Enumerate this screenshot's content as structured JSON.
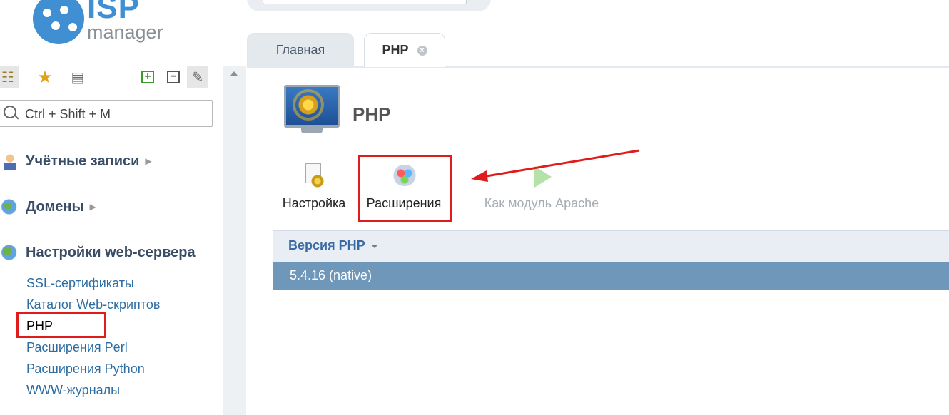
{
  "logo": {
    "top": "ISP",
    "bottom": "manager"
  },
  "sidebar": {
    "search_placeholder": "Ctrl + Shift + M",
    "groups": [
      {
        "label": "Учётные записи",
        "expandable": true
      },
      {
        "label": "Домены",
        "expandable": true
      },
      {
        "label": "Настройки web-сервера",
        "expandable": false
      }
    ],
    "subitems": [
      "SSL-сертификаты",
      "Каталог Web-скриптов",
      "PHP",
      "Расширения Perl",
      "Расширения Python",
      "WWW-журналы"
    ],
    "active_subitem": "PHP"
  },
  "tabs": [
    {
      "label": "Главная",
      "active": false
    },
    {
      "label": "PHP",
      "active": true,
      "closable": true
    }
  ],
  "page": {
    "title": "PHP"
  },
  "toolbar": {
    "settings_label": "Настройка",
    "extensions_label": "Расширения",
    "apache_label": "Как модуль Apache"
  },
  "table": {
    "column_header": "Версия PHP",
    "rows": [
      "5.4.16 (native)"
    ]
  },
  "colors": {
    "accent": "#3f8fd2",
    "highlight": "#e01b1b",
    "selected_row": "#6e97ba",
    "link": "#2e6da4"
  },
  "icons": [
    "tree-icon",
    "star-icon",
    "clipboard-icon",
    "expand-all-icon",
    "collapse-all-icon",
    "pin-icon",
    "search-icon",
    "settings-icon",
    "extensions-icon",
    "play-icon",
    "monitor-gear-icon"
  ]
}
